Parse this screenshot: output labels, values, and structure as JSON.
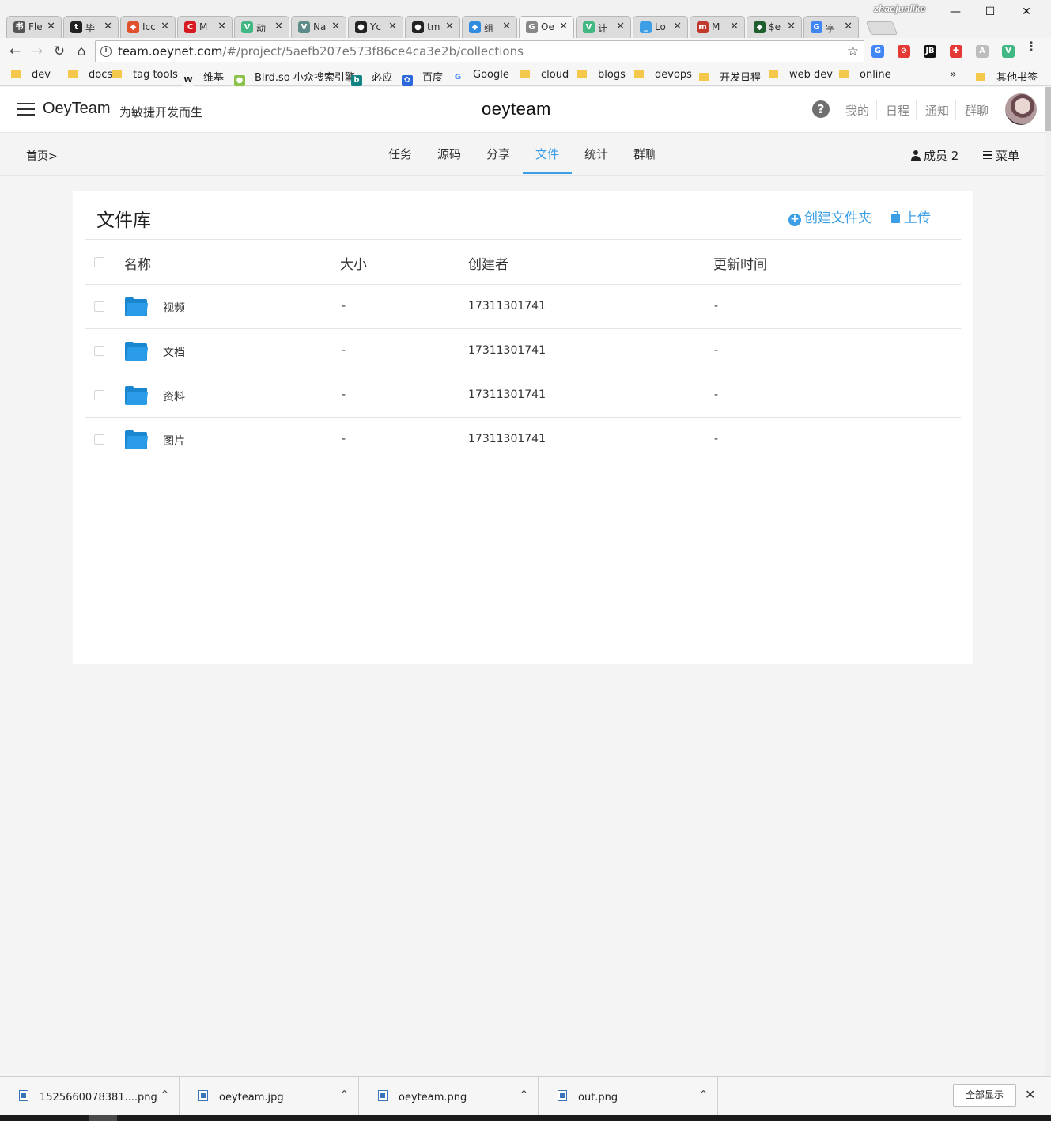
{
  "window": {
    "user": "zhaojunlike",
    "minimize": "—",
    "maximize": "☐",
    "close": "✕"
  },
  "tabs": [
    {
      "label": "Fle",
      "icon_color": "#555555",
      "icon_char": "书"
    },
    {
      "label": "毕",
      "icon_color": "#222222",
      "icon_char": "t"
    },
    {
      "label": "Icc",
      "icon_color": "#e1502d",
      "icon_char": "◆"
    },
    {
      "label": "M",
      "icon_color": "#d71a20",
      "icon_char": "C"
    },
    {
      "label": "动",
      "icon_color": "#41b883",
      "icon_char": "V"
    },
    {
      "label": "Na",
      "icon_color": "#5e8c8a",
      "icon_char": "V"
    },
    {
      "label": "Yc",
      "icon_color": "#222222",
      "icon_char": "●"
    },
    {
      "label": "tm",
      "icon_color": "#222222",
      "icon_char": "●"
    },
    {
      "label": "组",
      "icon_color": "#2f8be0",
      "icon_char": "◆"
    },
    {
      "label": "Oe",
      "icon_color": "#888888",
      "icon_char": "G"
    },
    {
      "label": "计",
      "icon_color": "#41b883",
      "icon_char": "V"
    },
    {
      "label": "Lo",
      "icon_color": "#3c9ee5",
      "icon_char": "_"
    },
    {
      "label": "M",
      "icon_color": "#c0392b",
      "icon_char": "m"
    },
    {
      "label": "$e",
      "icon_color": "#1e5f2e",
      "icon_char": "◆"
    },
    {
      "label": "字",
      "icon_color": "#4285f4",
      "icon_char": "G"
    }
  ],
  "tab_close": "✕",
  "toolbar": {
    "back": "←",
    "forward": "→",
    "reload": "↻",
    "home": "⌂",
    "url_host": "team.oeynet.com",
    "url_path": "/#/project/5aefb207e573f86ce4ca3e2b/collections",
    "info_icon": "i",
    "star": "☆",
    "menu": "⋮"
  },
  "extensions": [
    {
      "name": "translate-icon",
      "char": "G",
      "color": "#4285f4"
    },
    {
      "name": "adblock-icon",
      "char": "⊘",
      "color": "#e53935"
    },
    {
      "name": "jetbrains-icon",
      "char": "JB",
      "color": "#111111"
    },
    {
      "name": "extension-red-icon",
      "char": "✚",
      "color": "#e53935"
    },
    {
      "name": "angular-icon",
      "char": "A",
      "color": "#bdbdbd"
    },
    {
      "name": "vue-devtools-icon",
      "char": "V",
      "color": "#41b883"
    }
  ],
  "bookmarks": [
    {
      "label": "dev",
      "type": "folder"
    },
    {
      "label": "docs",
      "type": "folder"
    },
    {
      "label": "tag tools",
      "type": "folder"
    },
    {
      "label": "维基",
      "type": "icon",
      "char": "W",
      "color": "#f6f6f6",
      "fg": "#111111"
    },
    {
      "label": "Bird.so 小众搜索引擎",
      "type": "icon",
      "char": "●",
      "color": "#8bc34a",
      "fg": "#ffffff"
    },
    {
      "label": "必应",
      "type": "icon",
      "char": "b",
      "color": "#138484",
      "fg": "#ffffff"
    },
    {
      "label": "百度",
      "type": "icon",
      "char": "✿",
      "color": "#2b68d9",
      "fg": "#ffffff"
    },
    {
      "label": "Google",
      "type": "icon",
      "char": "G",
      "color": "#f6f6f6",
      "fg": "#4285f4"
    },
    {
      "label": "cloud",
      "type": "folder"
    },
    {
      "label": "blogs",
      "type": "folder"
    },
    {
      "label": "devops",
      "type": "folder"
    },
    {
      "label": "开发日程",
      "type": "folder"
    },
    {
      "label": "web dev",
      "type": "folder"
    },
    {
      "label": "online",
      "type": "folder"
    }
  ],
  "bookmarks_more": "»",
  "other_bookmarks": "其他书签",
  "header": {
    "brand": "OeyTeam",
    "tagline": "为敏捷开发而生",
    "logo": "oeyteam",
    "help": "?",
    "links": [
      "我的",
      "日程",
      "通知",
      "群聊"
    ]
  },
  "subnav": {
    "breadcrumb": "首页>",
    "tabs": [
      "任务",
      "源码",
      "分享",
      "文件",
      "统计",
      "群聊"
    ],
    "active_tab": "文件",
    "members_label": "成员",
    "members_count": "2",
    "menu_label": "菜单"
  },
  "library": {
    "title": "文件库",
    "create_folder": "创建文件夹",
    "upload": "上传",
    "columns": [
      "名称",
      "大小",
      "创建者",
      "更新时间"
    ],
    "rows": [
      {
        "name": "视频",
        "size": "-",
        "creator": "17311301741",
        "updated": "-"
      },
      {
        "name": "文档",
        "size": "-",
        "creator": "17311301741",
        "updated": "-"
      },
      {
        "name": "资料",
        "size": "-",
        "creator": "17311301741",
        "updated": "-"
      },
      {
        "name": "图片",
        "size": "-",
        "creator": "17311301741",
        "updated": "-"
      }
    ]
  },
  "downloads": {
    "items": [
      "1525660078381....png",
      "oeyteam.jpg",
      "oeyteam.png",
      "out.png"
    ],
    "caret": "^",
    "show_all": "全部显示",
    "close": "✕"
  },
  "colors": {
    "accent": "#3c9ee5",
    "folder": "#2a9be6"
  }
}
